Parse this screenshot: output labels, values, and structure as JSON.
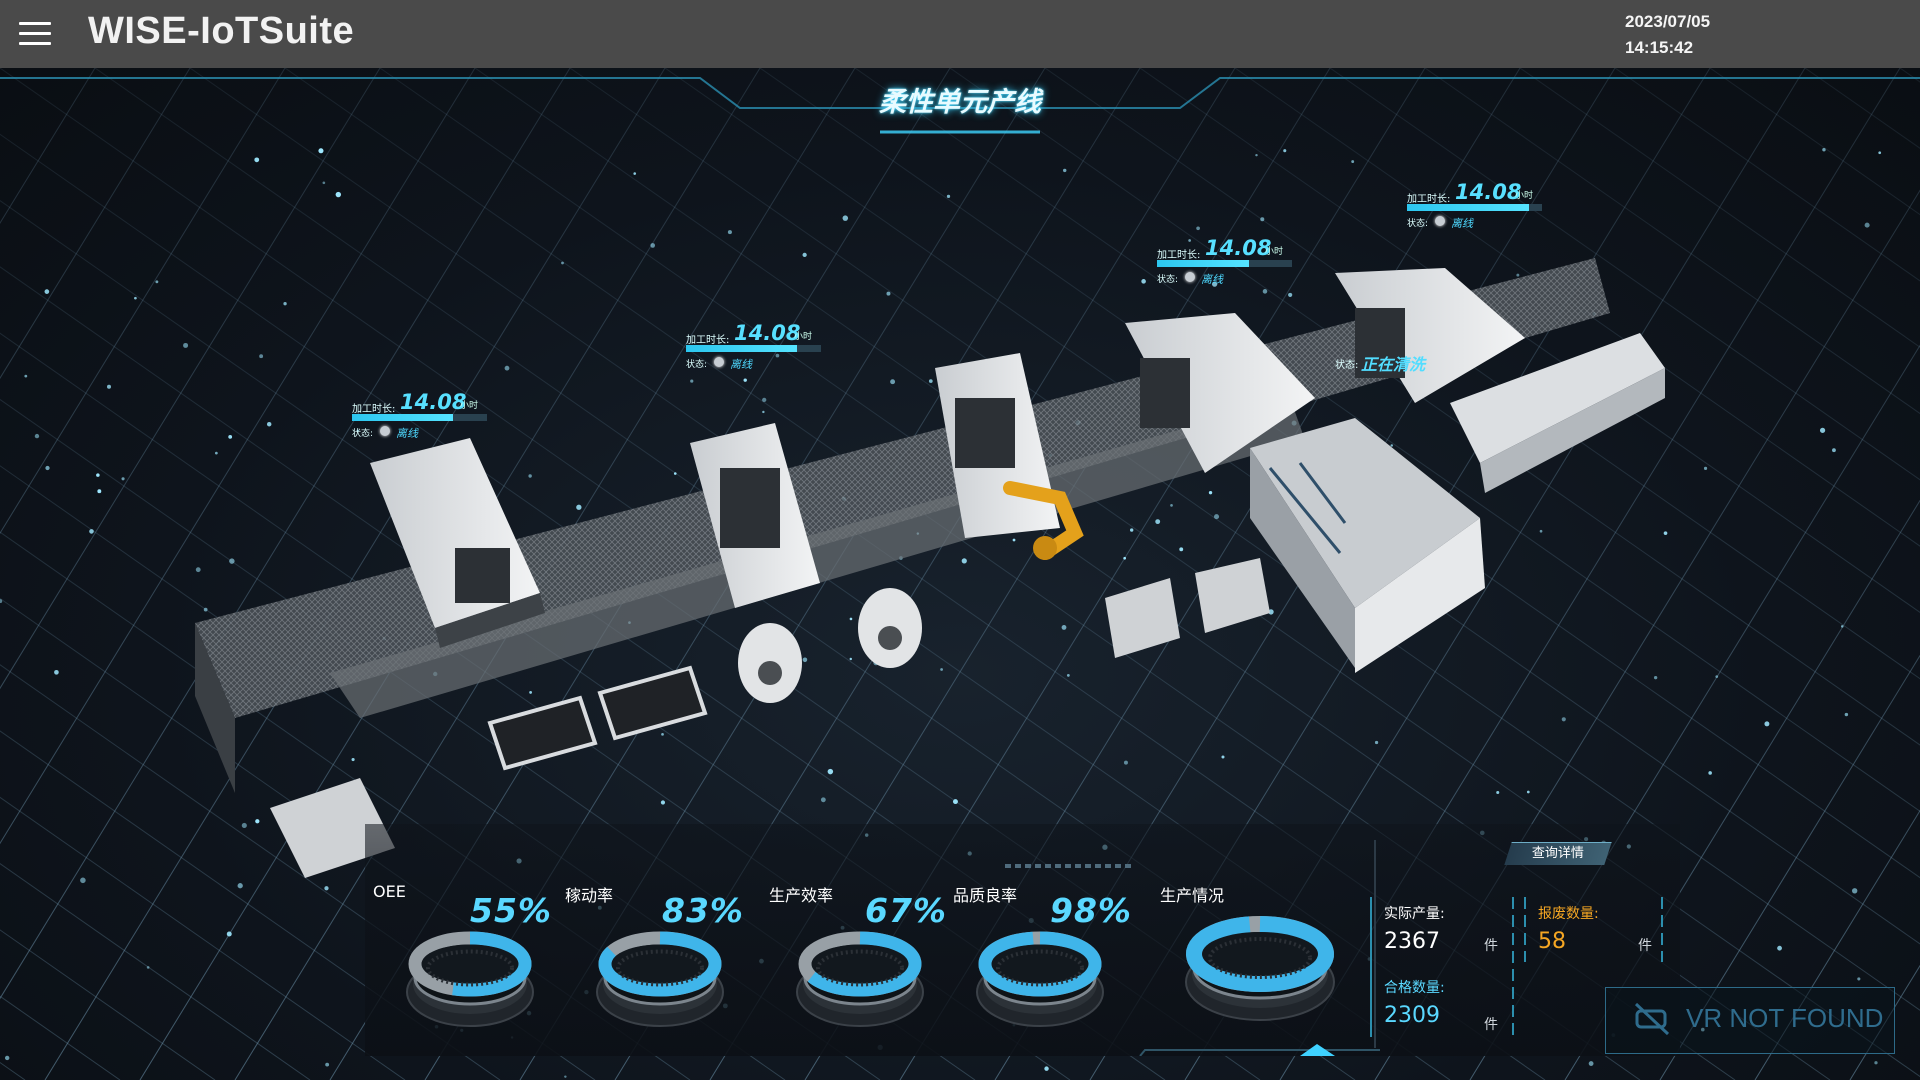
{
  "header": {
    "app_title": "WISE-IoTSuite",
    "date": "2023/07/05",
    "time": "14:15:42"
  },
  "scene": {
    "title": "柔性单元产线",
    "machines": [
      {
        "label_duration": "加工时长:",
        "duration": "14.08",
        "unit": "小时",
        "label_status": "状态:",
        "status": "离线",
        "progress_fraction": 0.75
      },
      {
        "label_duration": "加工时长:",
        "duration": "14.08",
        "unit": "小时",
        "label_status": "状态:",
        "status": "离线",
        "progress_fraction": 0.82
      },
      {
        "label_duration": "加工时长:",
        "duration": "14.08",
        "unit": "小时",
        "label_status": "状态:",
        "status": "离线",
        "progress_fraction": 0.68
      },
      {
        "label_duration": "加工时长:",
        "duration": "14.08",
        "unit": "小时",
        "label_status": "状态:",
        "status": "离线",
        "progress_fraction": 0.9
      }
    ],
    "wash_station": {
      "label_status": "状态:",
      "status": "正在清洗"
    }
  },
  "kpis": [
    {
      "label": "OEE",
      "value": "55%",
      "fraction": 0.55
    },
    {
      "label": "稼动率",
      "value": "83%",
      "fraction": 0.83
    },
    {
      "label": "生产效率",
      "value": "67%",
      "fraction": 0.67
    },
    {
      "label": "品质良率",
      "value": "98%",
      "fraction": 0.98
    }
  ],
  "production": {
    "label": "生产情况",
    "query_button": "查询详情",
    "actual_label": "实际产量:",
    "actual_value": "2367",
    "scrap_label": "报废数量:",
    "scrap_value": "58",
    "qualified_label": "合格数量:",
    "qualified_value": "2309",
    "unit": "件",
    "qualified_fraction": 0.975
  },
  "vr": {
    "text": "VR NOT FOUND",
    "icon": "vr-off-icon"
  },
  "colors": {
    "accent": "#5ad8ff",
    "scrap": "#f5a623",
    "header_bg": "#4a4a4a"
  }
}
